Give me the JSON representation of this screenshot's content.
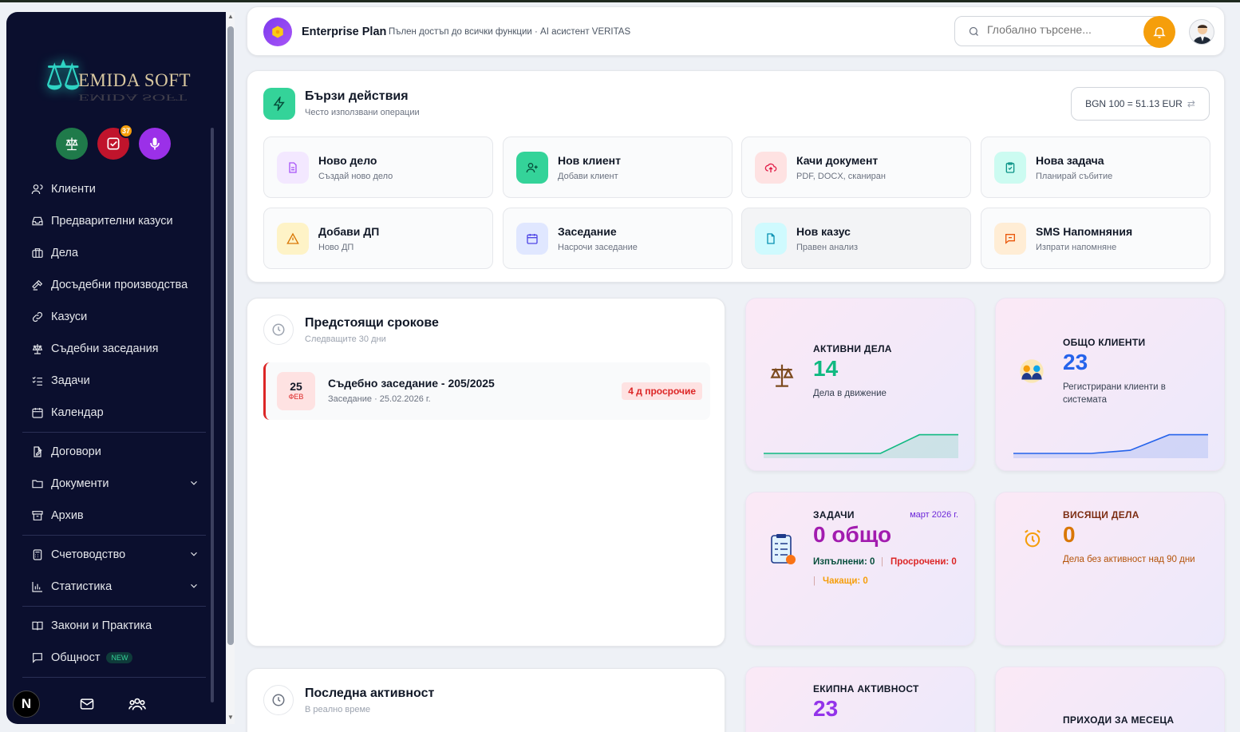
{
  "brand": {
    "name": "EMIDA SOFT"
  },
  "sidebar": {
    "badge_count": "37",
    "items": [
      {
        "label": "Клиенти"
      },
      {
        "label": "Предварителни казуси"
      },
      {
        "label": "Дела"
      },
      {
        "label": "Досъдебни производства"
      },
      {
        "label": "Казуси"
      },
      {
        "label": "Съдебни заседания"
      },
      {
        "label": "Задачи"
      },
      {
        "label": "Календар"
      },
      {
        "label": "Договори"
      },
      {
        "label": "Документи"
      },
      {
        "label": "Архив"
      },
      {
        "label": "Счетоводство"
      },
      {
        "label": "Статистика"
      },
      {
        "label": "Закони и Практика"
      },
      {
        "label": "Общност"
      }
    ],
    "new_badge": "NEW",
    "n_logo": "N"
  },
  "header": {
    "plan_title": "Enterprise Plan",
    "plan_sub": "Пълен достъп до всички функции · AI асистент VERITAS",
    "search_placeholder": "Глобално търсене..."
  },
  "quick_actions": {
    "title": "Бързи действия",
    "subtitle": "Често използвани операции",
    "rate": "BGN 100 = 51.13 EUR",
    "tiles": [
      {
        "title": "Ново дело",
        "sub": "Създай ново дело"
      },
      {
        "title": "Нов клиент",
        "sub": "Добави клиент"
      },
      {
        "title": "Качи документ",
        "sub": "PDF, DOCX, сканиран"
      },
      {
        "title": "Нова задача",
        "sub": "Планирай събитие"
      },
      {
        "title": "Добави ДП",
        "sub": "Ново ДП"
      },
      {
        "title": "Заседание",
        "sub": "Насрочи заседание"
      },
      {
        "title": "Нов казус",
        "sub": "Правен анализ"
      },
      {
        "title": "SMS Напомняния",
        "sub": "Изпрати напомняне"
      }
    ]
  },
  "deadlines": {
    "title": "Предстоящи срокове",
    "subtitle": "Следващите 30 дни",
    "items": [
      {
        "day": "25",
        "month": "ФЕВ",
        "title": "Съдебно заседание - 205/2025",
        "sub": "Заседание · 25.02.2026 г.",
        "status": "4 д просрочие"
      }
    ]
  },
  "activity": {
    "title": "Последна активност",
    "subtitle": "В реално време"
  },
  "stats": {
    "active_cases": {
      "label": "АКТИВНИ ДЕЛА",
      "value": "14",
      "desc": "Дела в движение",
      "color": "#10b981",
      "trend": [
        0,
        0,
        0,
        0,
        0.9,
        0.9
      ]
    },
    "clients": {
      "label": "ОБЩО КЛИЕНТИ",
      "value": "23",
      "desc": "Регистрирани клиенти в системата",
      "color": "#2563eb",
      "trend": [
        0,
        0,
        0,
        0.15,
        0.9,
        0.9
      ]
    },
    "tasks": {
      "label": "ЗАДАЧИ",
      "month": "март 2026 г.",
      "value": "0 общо",
      "done": "Изпълнени: 0",
      "overdue": "Просрочени: 0",
      "pending": "Чакащи: 0"
    },
    "hanging": {
      "label": "ВИСЯЩИ ДЕЛА",
      "value": "0",
      "desc": "Дела без активност над 90 дни"
    },
    "team": {
      "label": "ЕКИПНА АКТИВНОСТ",
      "value": "23"
    },
    "income": {
      "label": "ПРИХОДИ ЗА МЕСЕЦА"
    }
  }
}
